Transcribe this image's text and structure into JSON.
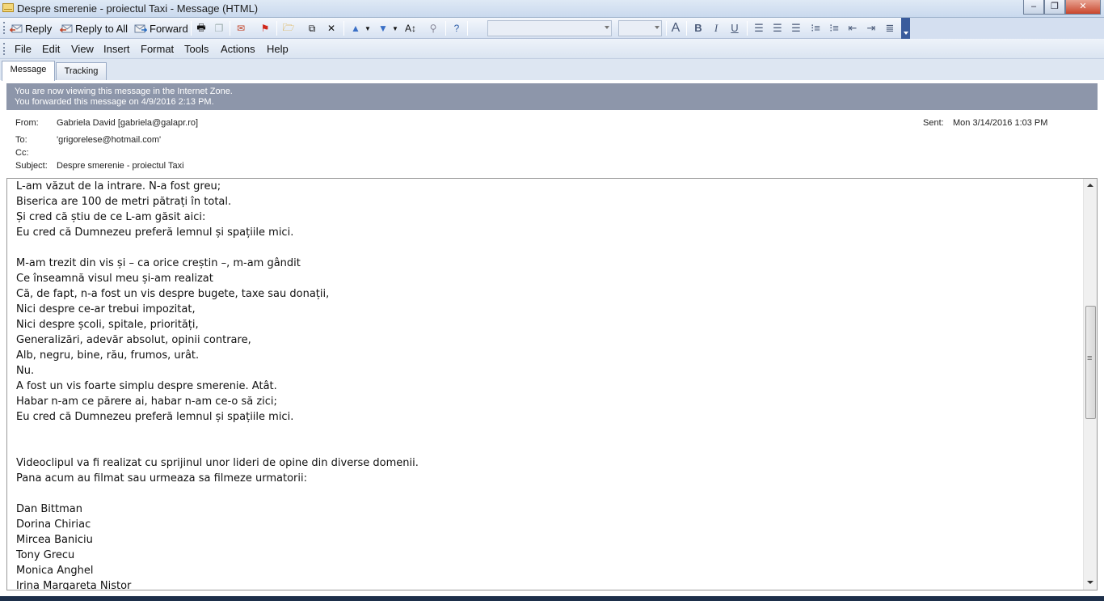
{
  "window": {
    "title": "Despre smerenie - proiectul Taxi - Message (HTML)",
    "minimize": "‒",
    "maximize": "❐",
    "close": "✕"
  },
  "toolbar": {
    "reply": "Reply",
    "reply_all": "Reply to All",
    "forward": "Forward"
  },
  "menu": [
    "File",
    "Edit",
    "View",
    "Insert",
    "Format",
    "Tools",
    "Actions",
    "Help"
  ],
  "tabs": [
    "Message",
    "Tracking"
  ],
  "banner": {
    "line1": "You are now viewing this message in the Internet Zone.",
    "line2": "You forwarded this message on 4/9/2016 2:13 PM."
  },
  "header": {
    "from_label": "From:",
    "from": "Gabriela David [gabriela@galapr.ro]",
    "sent_label": "Sent:",
    "sent": "Mon 3/14/2016 1:03 PM",
    "to_label": "To:",
    "to": "'grigorelese@hotmail.com'",
    "cc_label": "Cc:",
    "cc": "",
    "subject_label": "Subject:",
    "subject": "Despre smerenie - proiectul Taxi"
  },
  "body_lines": [
    "L-am văzut de la intrare. N-a fost greu;",
    "Biserica are 100 de metri pătrați în total.",
    "Și cred că știu de ce L-am găsit aici:",
    "Eu cred că Dumnezeu preferă lemnul și spațiile mici.",
    "",
    "M-am trezit din vis și – ca orice creștin –, m-am gândit",
    "Ce înseamnă visul meu și-am realizat",
    "Că, de fapt, n-a fost un vis despre bugete, taxe sau donații,",
    "Nici despre ce-ar trebui impozitat,",
    "Nici despre școli, spitale, priorități,",
    "Generalizări, adevăr absolut, opinii contrare,",
    "Alb, negru, bine, rău, frumos, urât.",
    "Nu.",
    "A fost un vis foarte simplu despre smerenie. Atât.",
    "Habar n-am ce părere ai, habar n-am ce-o să zici;",
    "Eu cred că Dumnezeu preferă lemnul și spațiile mici.",
    "",
    "",
    "Videoclipul va fi realizat cu sprijinul unor lideri de opine din diverse domenii.",
    "Pana acum au filmat sau urmeaza sa filmeze urmatorii:",
    "",
    "Dan Bittman",
    "Dorina Chiriac",
    "Mircea Baniciu",
    "Tony Grecu",
    "Monica Anghel",
    "Irina Margareta Nistor"
  ]
}
